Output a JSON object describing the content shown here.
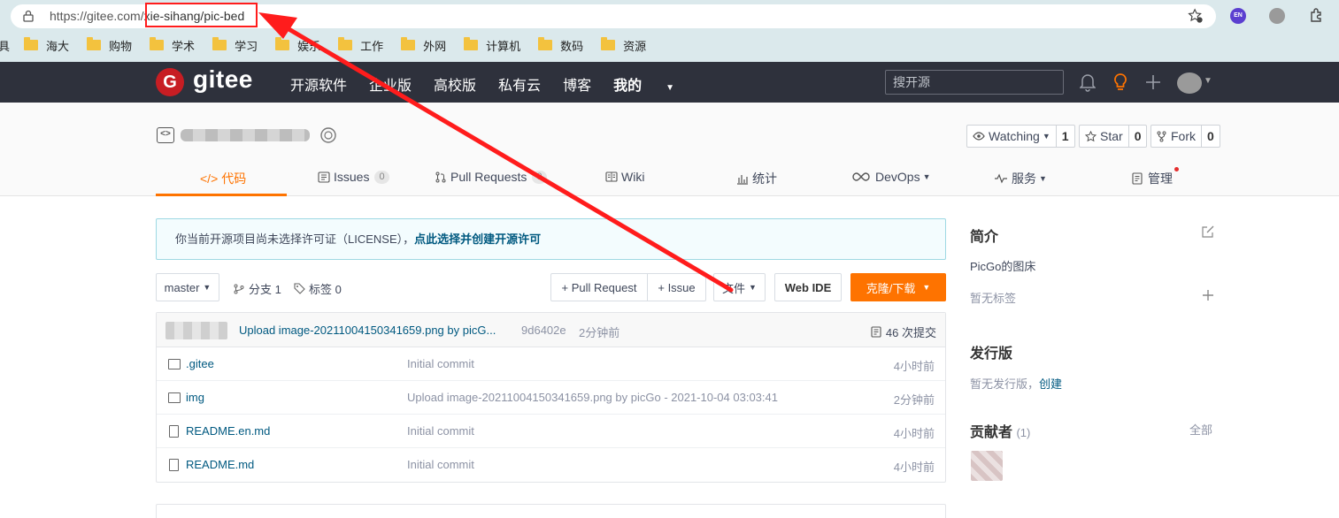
{
  "browser": {
    "url_prefix": "https://gitee.com/",
    "url_path": "xie-sihang/pic-bed",
    "ext_en": "EN",
    "bookmarks_first": "具",
    "bookmarks": [
      "海大",
      "购物",
      "学术",
      "学习",
      "娱乐",
      "工作",
      "外网",
      "计算机",
      "数码",
      "资源"
    ]
  },
  "header": {
    "logo_letter": "G",
    "logo_text": "gitee",
    "nav": [
      "开源软件",
      "企业版",
      "高校版",
      "私有云",
      "博客"
    ],
    "nav_mine": "我的",
    "search_placeholder": "搜开源"
  },
  "project": {
    "watching_label": "Watching",
    "watching_count": "1",
    "star_label": "Star",
    "star_count": "0",
    "fork_label": "Fork",
    "fork_count": "0",
    "tabs": {
      "code": "代码",
      "issues": "Issues",
      "issues_count": "0",
      "pulls": "Pull Requests",
      "pulls_count": "0",
      "wiki": "Wiki",
      "stats": "统计",
      "devops": "DevOps",
      "services": "服务",
      "manage": "管理"
    }
  },
  "main": {
    "license_text": "你当前开源项目尚未选择许可证（LICENSE），",
    "license_link": "点此选择并创建开源许可",
    "branch": "master",
    "branches": "分支 1",
    "tags": "标签 0",
    "btn_pull_request": "+ Pull Request",
    "btn_issue": "+ Issue",
    "btn_file": "文件",
    "btn_webide": "Web IDE",
    "btn_clone": "克隆/下载",
    "last_commit": {
      "message": "Upload image-20211004150341659.png by picG...",
      "hash": "9d6402e",
      "time": "2分钟前",
      "count": "46 次提交"
    },
    "files": [
      {
        "name": ".gitee",
        "type": "dir",
        "message": "Initial commit",
        "time": "4小时前"
      },
      {
        "name": "img",
        "type": "dir",
        "message": "Upload image-20211004150341659.png by picGo - 2021-10-04 03:03:41",
        "time": "2分钟前"
      },
      {
        "name": "README.en.md",
        "type": "file",
        "message": "Initial commit",
        "time": "4小时前"
      },
      {
        "name": "README.md",
        "type": "file",
        "message": "Initial commit",
        "time": "4小时前"
      }
    ]
  },
  "sidebar": {
    "intro_title": "简介",
    "intro_text": "PicGo的图床",
    "no_tags": "暂无标签",
    "release_title": "发行版",
    "no_release": "暂无发行版，",
    "create": "创建",
    "contributors_title": "贡献者",
    "contributors_count": "(1)",
    "all": "全部"
  },
  "colors": {
    "accent": "#fe7300",
    "header_bg": "#2e313c",
    "link": "#005980",
    "annotation": "#ff1c1c"
  }
}
